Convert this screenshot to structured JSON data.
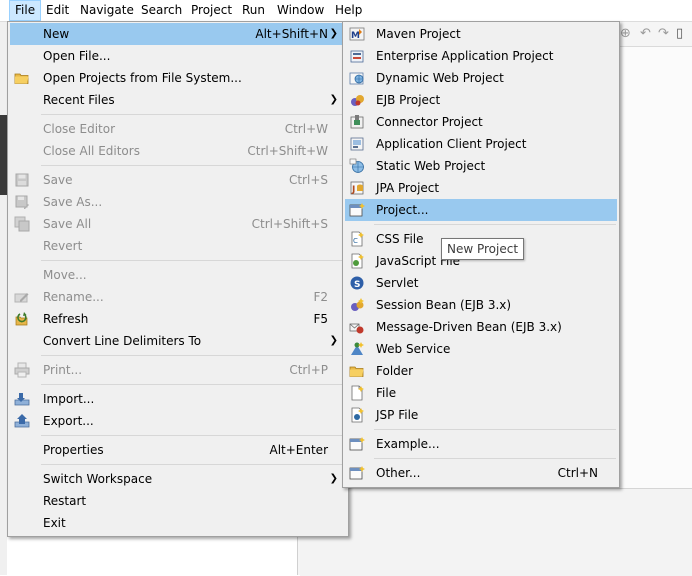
{
  "menubar": {
    "items": [
      {
        "label": "File"
      },
      {
        "label": "Edit"
      },
      {
        "label": "Navigate"
      },
      {
        "label": "Search"
      },
      {
        "label": "Project"
      },
      {
        "label": "Run"
      },
      {
        "label": "Window"
      },
      {
        "label": "Help"
      }
    ]
  },
  "file_menu": {
    "items": [
      {
        "label": "New",
        "accel": "Alt+Shift+N",
        "submenu": true,
        "highlighted": true
      },
      {
        "label": "Open File...",
        "accel": ""
      },
      {
        "label": "Open Projects from File System...",
        "accel": "",
        "icon": "folder-icon"
      },
      {
        "label": "Recent Files",
        "accel": "",
        "submenu": true
      },
      {
        "label": "Close Editor",
        "accel": "Ctrl+W",
        "disabled": true
      },
      {
        "label": "Close All Editors",
        "accel": "Ctrl+Shift+W",
        "disabled": true
      },
      {
        "label": "Save",
        "accel": "Ctrl+S",
        "disabled": true,
        "icon": "save-icon"
      },
      {
        "label": "Save As...",
        "accel": "",
        "disabled": true,
        "icon": "save-as-icon"
      },
      {
        "label": "Save All",
        "accel": "Ctrl+Shift+S",
        "disabled": true,
        "icon": "save-all-icon"
      },
      {
        "label": "Revert",
        "accel": "",
        "disabled": true
      },
      {
        "label": "Move...",
        "accel": "",
        "disabled": true
      },
      {
        "label": "Rename...",
        "accel": "F2",
        "disabled": true,
        "icon": "rename-icon"
      },
      {
        "label": "Refresh",
        "accel": "F5",
        "icon": "refresh-icon"
      },
      {
        "label": "Convert Line Delimiters To",
        "accel": "",
        "submenu": true
      },
      {
        "label": "Print...",
        "accel": "Ctrl+P",
        "disabled": true,
        "icon": "print-icon"
      },
      {
        "label": "Import...",
        "accel": "",
        "icon": "import-icon"
      },
      {
        "label": "Export...",
        "accel": "",
        "icon": "export-icon"
      },
      {
        "label": "Properties",
        "accel": "Alt+Enter"
      },
      {
        "label": "Switch Workspace",
        "accel": "",
        "submenu": true
      },
      {
        "label": "Restart",
        "accel": ""
      },
      {
        "label": "Exit",
        "accel": ""
      }
    ]
  },
  "new_menu": {
    "items": [
      {
        "label": "Maven Project",
        "icon": "maven-project-icon"
      },
      {
        "label": "Enterprise Application Project",
        "icon": "enterprise-app-project-icon"
      },
      {
        "label": "Dynamic Web Project",
        "icon": "dynamic-web-project-icon"
      },
      {
        "label": "EJB Project",
        "icon": "ejb-project-icon"
      },
      {
        "label": "Connector Project",
        "icon": "connector-project-icon"
      },
      {
        "label": "Application Client Project",
        "icon": "app-client-project-icon"
      },
      {
        "label": "Static Web Project",
        "icon": "static-web-project-icon"
      },
      {
        "label": "JPA Project",
        "icon": "jpa-project-icon"
      },
      {
        "label": "Project...",
        "icon": "project-icon",
        "highlighted": true
      },
      {
        "label": "CSS File",
        "icon": "css-file-icon"
      },
      {
        "label": "JavaScript File",
        "icon": "javascript-file-icon"
      },
      {
        "label": "Servlet",
        "icon": "servlet-icon"
      },
      {
        "label": "Session Bean (EJB 3.x)",
        "icon": "session-bean-icon"
      },
      {
        "label": "Message-Driven Bean (EJB 3.x)",
        "icon": "message-driven-bean-icon"
      },
      {
        "label": "Web Service",
        "icon": "web-service-icon"
      },
      {
        "label": "Folder",
        "icon": "folder-icon"
      },
      {
        "label": "File",
        "icon": "file-icon"
      },
      {
        "label": "JSP File",
        "icon": "jsp-file-icon"
      },
      {
        "label": "Example...",
        "icon": "example-icon"
      },
      {
        "label": "Other...",
        "accel": "Ctrl+N",
        "icon": "other-icon"
      }
    ]
  },
  "tooltip": {
    "text": "New Project"
  },
  "colors": {
    "menu_bg": "#f0f0f0",
    "highlight": "#99c9ef",
    "menubar_active": "#cce8ff",
    "disabled_text": "#8d8d8d"
  }
}
